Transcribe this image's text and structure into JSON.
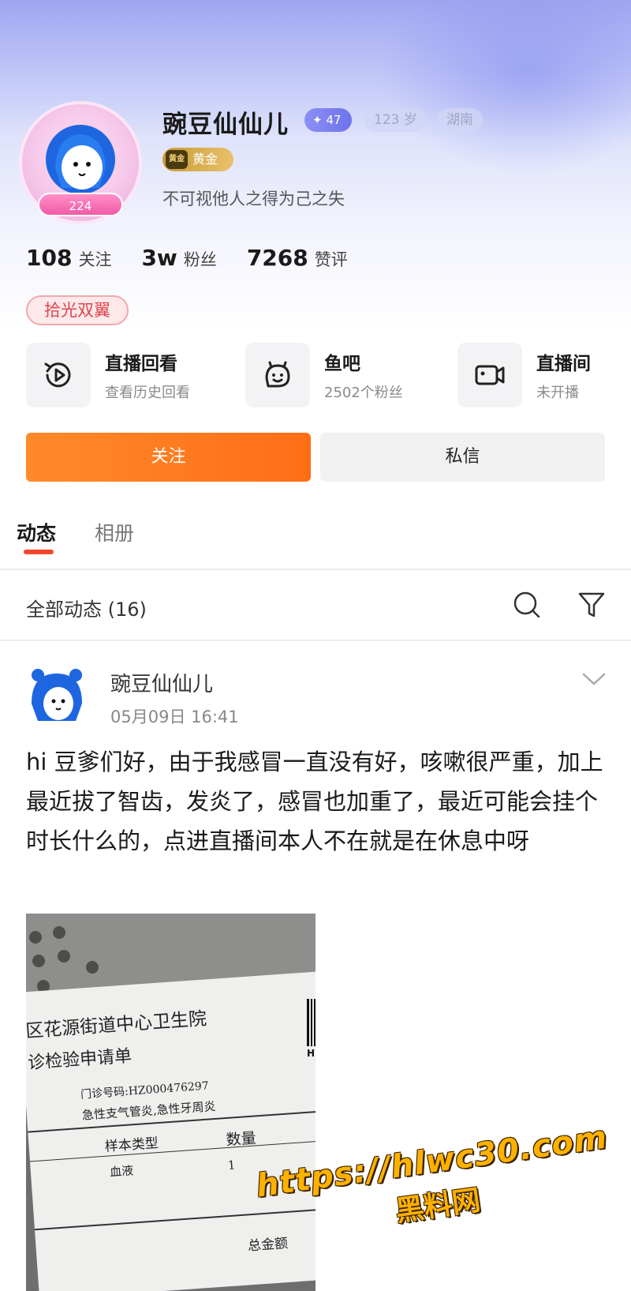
{
  "profile": {
    "name": "豌豆仙仙儿",
    "avatar_level": "224",
    "fan_level": "47",
    "age": "123 岁",
    "location": "湖南",
    "tier_icon": "黄金",
    "tier": "黄金",
    "bio": "不可视他人之得为己之失"
  },
  "stats": [
    {
      "value": "108",
      "label": "关注"
    },
    {
      "value": "3w",
      "label": "粉丝"
    },
    {
      "value": "7268",
      "label": "赞评"
    }
  ],
  "honor_tag": "拾光双翼",
  "entries": [
    {
      "icon": "replay-icon",
      "title": "直播回看",
      "subtitle": "查看历史回看"
    },
    {
      "icon": "fishbar-icon",
      "title": "鱼吧",
      "subtitle": "2502个粉丝"
    },
    {
      "icon": "live-room-icon",
      "title": "直播间",
      "subtitle": "未开播"
    }
  ],
  "buttons": {
    "follow": "关注",
    "message": "私信"
  },
  "tabs": [
    {
      "label": "动态",
      "active": true
    },
    {
      "label": "相册",
      "active": false
    }
  ],
  "feed": {
    "title": "全部动态 (16)"
  },
  "post": {
    "author": "豌豆仙仙儿",
    "time": "05月09日 16:41",
    "body": "hi 豆爹们好，由于我感冒一直没有好，咳嗽很严重，加上最近拔了智齿，发炎了，感冒也加重了，最近可能会挂个时长什么的，点进直播间本人不在就是在休息中呀",
    "photo": {
      "line1": "区花源街道中心卫生院",
      "line2": "诊检验申请单",
      "clinic_no": "门诊号码:HZ000476297",
      "diagnosis": "急性支气管炎,急性牙周炎",
      "col_type": "样本类型",
      "col_qty": "数量",
      "sample": "血液",
      "qty": "1",
      "total": "总金额",
      "barcode_text": "H Z"
    }
  },
  "watermark": {
    "url": "https://hlwc30.com",
    "name": "黑料网"
  },
  "colors": {
    "accent_orange": "#ff7a1f",
    "tab_indicator": "#f2462c",
    "honor_red": "#e0444f",
    "fan_badge": "#7b80ef",
    "gold": "#d6a94c"
  }
}
